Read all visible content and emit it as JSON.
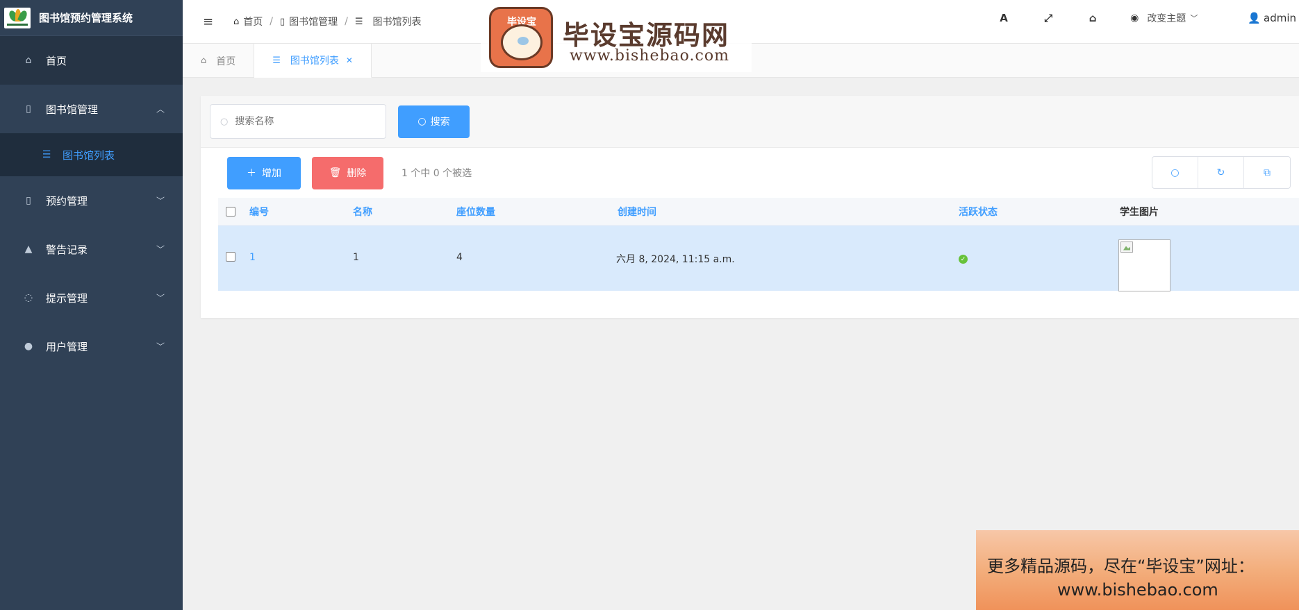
{
  "app": {
    "title": "图书馆预约管理系统"
  },
  "sidebar": {
    "items": [
      {
        "label": "首页",
        "icon": "home-icon"
      },
      {
        "label": "图书馆管理",
        "icon": "file-icon",
        "expanded": true,
        "children": [
          {
            "label": "图书馆列表",
            "icon": "list-icon"
          }
        ]
      },
      {
        "label": "预约管理",
        "icon": "file-icon"
      },
      {
        "label": "警告记录",
        "icon": "warning-icon"
      },
      {
        "label": "提示管理",
        "icon": "comment-icon"
      },
      {
        "label": "用户管理",
        "icon": "user-settings-icon"
      }
    ]
  },
  "header": {
    "breadcrumb": [
      "首页",
      "图书馆管理",
      "图书馆列表"
    ],
    "theme_label": "改变主题",
    "user": "admin",
    "icons": [
      "font-icon",
      "fullscreen-icon",
      "home-icon"
    ]
  },
  "tabs": [
    {
      "label": "首页",
      "icon": "home-icon",
      "active": false
    },
    {
      "label": "图书馆列表",
      "icon": "list-icon",
      "active": true,
      "closable": true
    }
  ],
  "search": {
    "placeholder": "搜索名称",
    "value": "",
    "button": "搜索"
  },
  "actions": {
    "add": "增加",
    "delete": "删除",
    "selection_info": "1 个中 0 个被选"
  },
  "table": {
    "columns": [
      "编号",
      "名称",
      "座位数量",
      "创建时间",
      "活跃状态",
      "学生图片"
    ],
    "rows": [
      {
        "id": "1",
        "name": "1",
        "seats": "4",
        "created": "六月 8, 2024, 11:15 a.m.",
        "active": true,
        "image": ""
      }
    ]
  },
  "watermark": {
    "badge": "毕设宝",
    "title": "毕设宝源码网",
    "url": "www.bishebao.com",
    "banner_line1": "更多精品源码，尽在“毕设宝”网址：",
    "banner_line2": "www.bishebao.com"
  },
  "colors": {
    "sidebar_bg": "#304156",
    "accent": "#409eff",
    "danger": "#f56c6c",
    "success": "#67c23a",
    "row_selected": "#d9eafc"
  }
}
